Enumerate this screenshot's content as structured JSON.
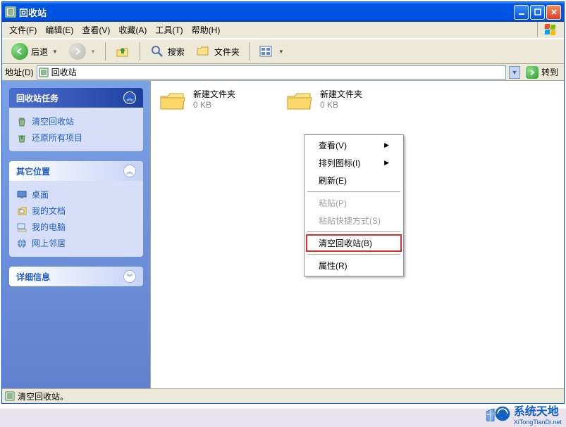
{
  "window": {
    "title": "回收站"
  },
  "menu": {
    "file": "文件(F)",
    "edit": "编辑(E)",
    "view": "查看(V)",
    "favorites": "收藏(A)",
    "tools": "工具(T)",
    "help": "帮助(H)"
  },
  "toolbar": {
    "back": "后退",
    "search": "搜索",
    "folders": "文件夹"
  },
  "address": {
    "label": "地址(D)",
    "value": "回收站",
    "go": "转到"
  },
  "sidebar": {
    "tasks": {
      "title": "回收站任务",
      "items": [
        "清空回收站",
        "还原所有项目"
      ]
    },
    "places": {
      "title": "其它位置",
      "items": [
        "桌面",
        "我的文档",
        "我的电脑",
        "网上邻居"
      ]
    },
    "details": {
      "title": "详细信息"
    }
  },
  "files": [
    {
      "name": "新建文件夹",
      "meta": "0 KB"
    },
    {
      "name": "新建文件夹",
      "meta": "0 KB"
    }
  ],
  "context": {
    "view": "查看(V)",
    "arrange": "排列图标(I)",
    "refresh": "刷新(E)",
    "paste": "粘贴(P)",
    "paste_shortcut": "粘贴快捷方式(S)",
    "empty": "清空回收站(B)",
    "properties": "属性(R)"
  },
  "status": {
    "text": "清空回收站。"
  },
  "watermark": {
    "line1": "系统天地",
    "line2": "XiTongTianDi.net"
  }
}
